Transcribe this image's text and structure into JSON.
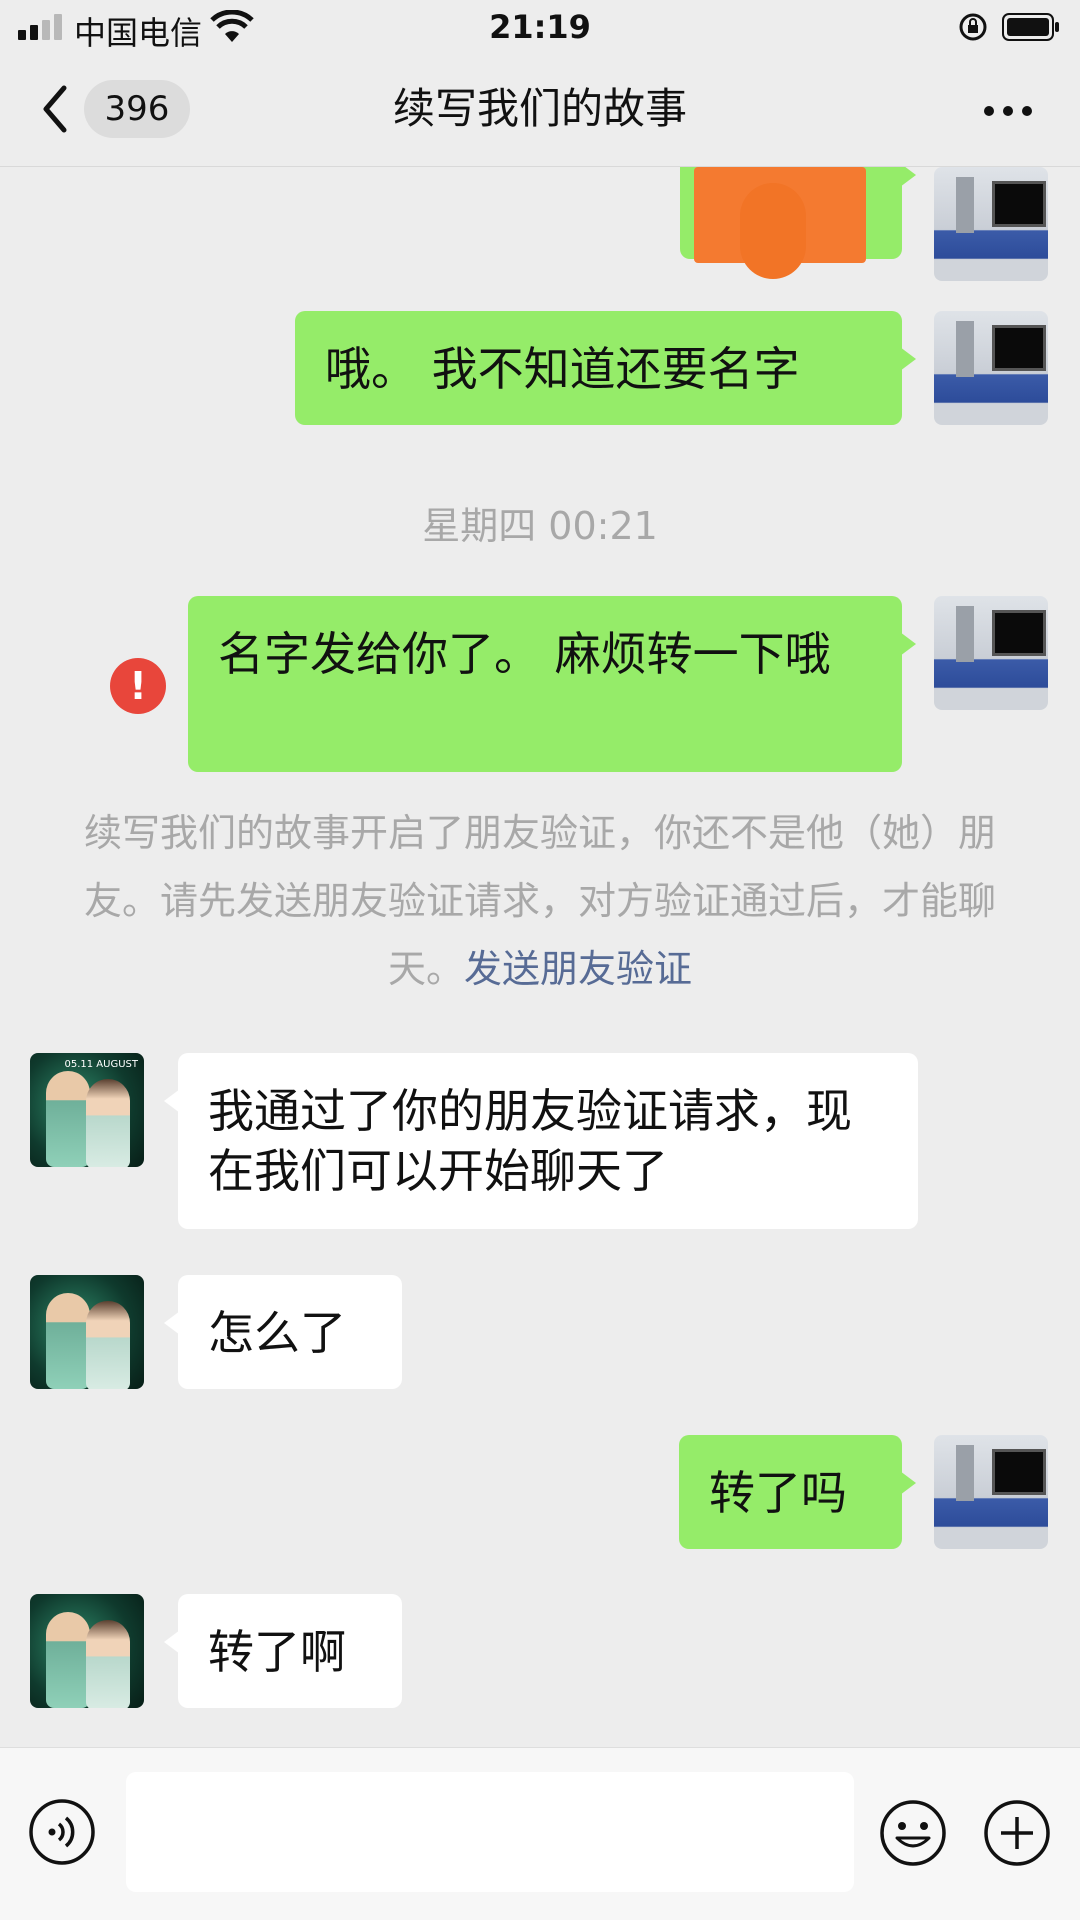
{
  "status_bar": {
    "carrier": "中国电信",
    "time": "21:19"
  },
  "nav": {
    "back_count": "396",
    "title": "续写我们的故事"
  },
  "messages": [
    {
      "from": "me",
      "text": "",
      "redacted": true
    },
    {
      "from": "me",
      "text": "哦。 我不知道还要名字"
    },
    {
      "type": "timestamp",
      "text": "星期四 00:21"
    },
    {
      "from": "me",
      "text": "名字发给你了。 麻烦转一下哦",
      "failed": true
    },
    {
      "type": "system",
      "text": "续写我们的故事开启了朋友验证，你还不是他（她）朋友。请先发送朋友验证请求，对方验证通过后，才能聊天。",
      "link": "发送朋友验证"
    },
    {
      "from": "them",
      "text": "我通过了你的朋友验证请求，现在我们可以开始聊天了"
    },
    {
      "from": "them",
      "text": "怎么了"
    },
    {
      "from": "me",
      "text": "转了吗"
    },
    {
      "from": "them",
      "text": "转了啊"
    }
  ],
  "avatar_badge": "05.11 AUGUST",
  "input": {
    "placeholder": ""
  },
  "colors": {
    "me_bubble": "#95ec69",
    "them_bubble": "#ffffff",
    "background": "#ededed",
    "link": "#576b95",
    "error": "#e8463b"
  },
  "icons": [
    "back-icon",
    "more-icon",
    "voice-icon",
    "emoji-icon",
    "plus-icon",
    "wifi-icon",
    "battery-icon",
    "lock-rotation-icon",
    "error-icon"
  ]
}
